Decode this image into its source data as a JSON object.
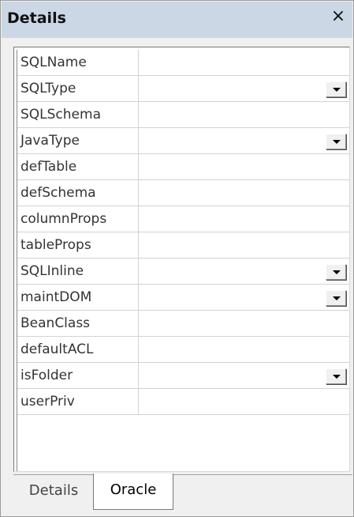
{
  "panel": {
    "title": "Details",
    "close_glyph": "×"
  },
  "properties": [
    {
      "name": "SQLName",
      "value": "",
      "has_dropdown": false
    },
    {
      "name": "SQLType",
      "value": "",
      "has_dropdown": true
    },
    {
      "name": "SQLSchema",
      "value": "",
      "has_dropdown": false
    },
    {
      "name": "JavaType",
      "value": "",
      "has_dropdown": true
    },
    {
      "name": "defTable",
      "value": "",
      "has_dropdown": false
    },
    {
      "name": "defSchema",
      "value": "",
      "has_dropdown": false
    },
    {
      "name": "columnProps",
      "value": "",
      "has_dropdown": false
    },
    {
      "name": "tableProps",
      "value": "",
      "has_dropdown": false
    },
    {
      "name": "SQLInline",
      "value": "",
      "has_dropdown": true
    },
    {
      "name": "maintDOM",
      "value": "",
      "has_dropdown": true
    },
    {
      "name": "BeanClass",
      "value": "",
      "has_dropdown": false
    },
    {
      "name": "defaultACL",
      "value": "",
      "has_dropdown": false
    },
    {
      "name": "isFolder",
      "value": "",
      "has_dropdown": true
    },
    {
      "name": "userPriv",
      "value": "",
      "has_dropdown": false
    }
  ],
  "tabs": [
    {
      "label": "Details",
      "active": false
    },
    {
      "label": "Oracle",
      "active": true
    }
  ],
  "colors": {
    "titlebar": "#cbd7e5",
    "panel_bg": "#f0f0f0",
    "grid_line": "#d2d2d2"
  }
}
